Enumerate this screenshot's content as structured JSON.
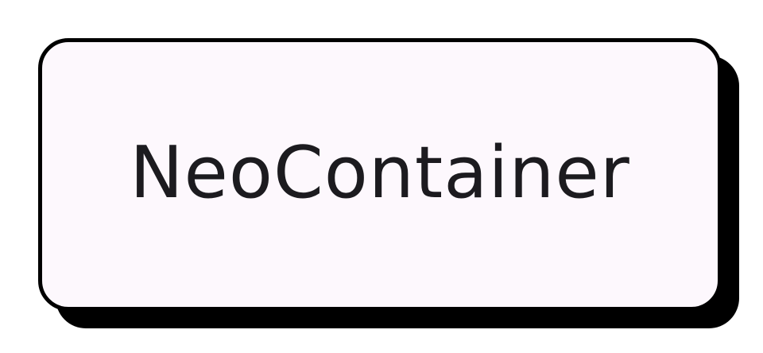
{
  "container": {
    "label": "NeoContainer"
  },
  "colors": {
    "background": "#ffffff",
    "surface": "#fdf8fd",
    "border": "#000000",
    "shadow": "#000000",
    "text": "#1c1b1f"
  }
}
